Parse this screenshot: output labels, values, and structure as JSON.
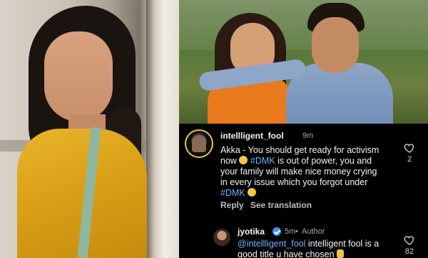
{
  "comment": {
    "username": "intellligent_fool",
    "time": "9m",
    "text_parts": {
      "a": "Akka - You should get ready for activism",
      "b": "now ",
      "c": " #DMK",
      "d": " is out of power, you and",
      "e": "your family will make nice money crying",
      "f": "in every issue which you forgot under",
      "g": "#DMK"
    },
    "reply_label": "Reply",
    "translate_label": "See translation",
    "like_count": "2"
  },
  "reply": {
    "username": "jyotika",
    "time": "5m",
    "role": "Author",
    "mention": "@intellligent_fool",
    "text_a": " intelligent fool is a",
    "text_b": "good title u have chosen",
    "like_count": "82"
  },
  "icons": {
    "like": "heart-outline-icon",
    "verified": "verified-badge-icon",
    "emoji": "grinning-sweat-emoji",
    "hand": "pointing-up-emoji"
  }
}
